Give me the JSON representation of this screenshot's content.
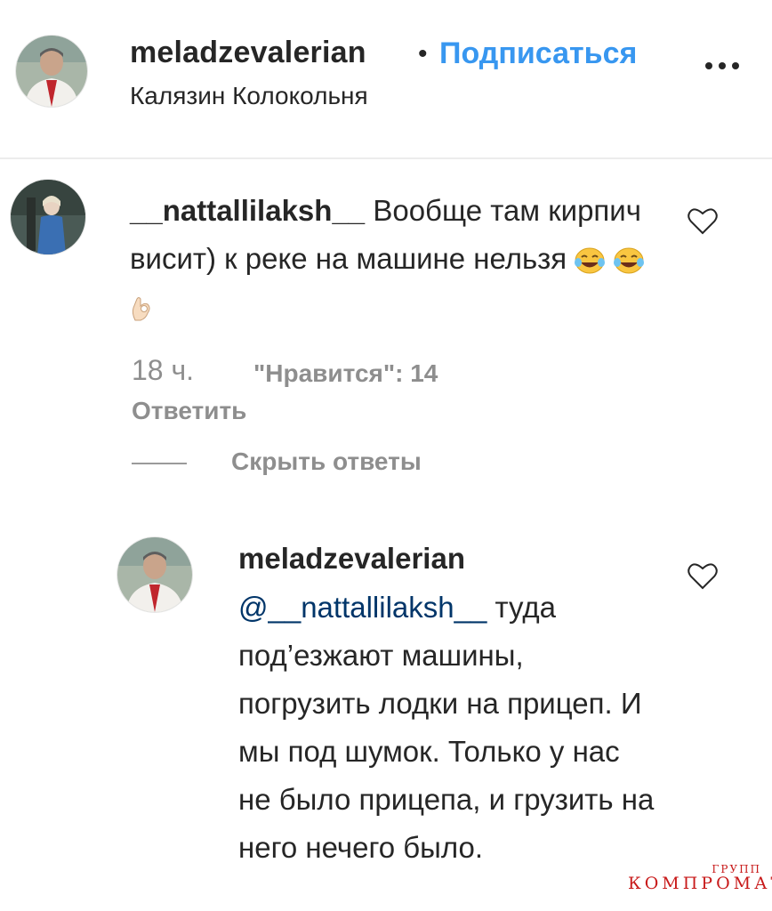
{
  "header": {
    "username": "meladzevalerian",
    "separator": "•",
    "follow_label": "Подписаться",
    "location": "Калязин Колокольня"
  },
  "comment": {
    "username": "__nattallilaksh__",
    "text": "Вообще там кирпич висит) к реке на машине нельзя",
    "emojis": [
      "face-with-tears-of-joy-emoji",
      "face-with-tears-of-joy-emoji",
      "ok-hand-emoji"
    ],
    "time": "18 ч.",
    "likes_label": "\"Нравится\": 14",
    "reply_label": "Ответить",
    "hide_replies_label": "Скрыть ответы"
  },
  "reply": {
    "username": "meladzevalerian",
    "mention": "@__nattallilaksh__",
    "text": "туда под’езжают машины, погрузить лодки на прицеп. И мы под шумок. Только у нас не было прицепа, и грузить на него нечего было."
  },
  "watermark": {
    "top": "ГРУПП",
    "main": "КОМПРОМАТ"
  },
  "colors": {
    "text": "#262626",
    "secondary": "#8e8e8e",
    "follow": "#3897f0",
    "mention": "#003569",
    "watermark": "#c81a1a"
  },
  "icons": [
    "more-options-icon",
    "heart-icon"
  ]
}
